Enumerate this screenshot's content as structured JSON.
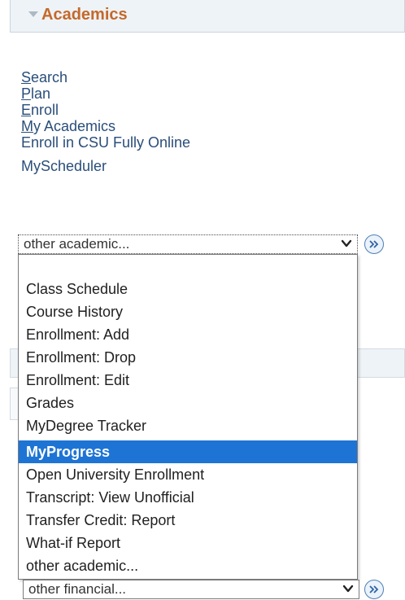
{
  "section": {
    "title": "Academics",
    "collapse_icon": "triangle-down-icon"
  },
  "links": [
    {
      "accel": "S",
      "rest": "earch"
    },
    {
      "accel": "P",
      "rest": "lan"
    },
    {
      "accel": "E",
      "rest": "nroll"
    },
    {
      "accel": "M",
      "rest": "y Academics"
    },
    {
      "accel": "",
      "rest": "Enroll in CSU Fully Online"
    },
    {
      "accel": "",
      "rest": "MyScheduler"
    }
  ],
  "academic_select": {
    "value": "other academic...",
    "go_icon": "double-chevron-right-icon",
    "options": [
      "Class Schedule",
      "Course History",
      "Enrollment: Add",
      "Enrollment: Drop",
      "Enrollment: Edit",
      "Grades",
      "MyDegree Tracker",
      "MyProgress",
      "Open University Enrollment",
      "Transcript: View Unofficial",
      "Transfer Credit: Report",
      "What-if Report",
      "other academic..."
    ],
    "highlighted": "MyProgress"
  },
  "financial_select": {
    "value": "other financial...",
    "go_icon": "double-chevron-right-icon"
  },
  "colors": {
    "header_text": "#c4692a",
    "link": "#2a4e7a",
    "highlight": "#1e74d4"
  }
}
